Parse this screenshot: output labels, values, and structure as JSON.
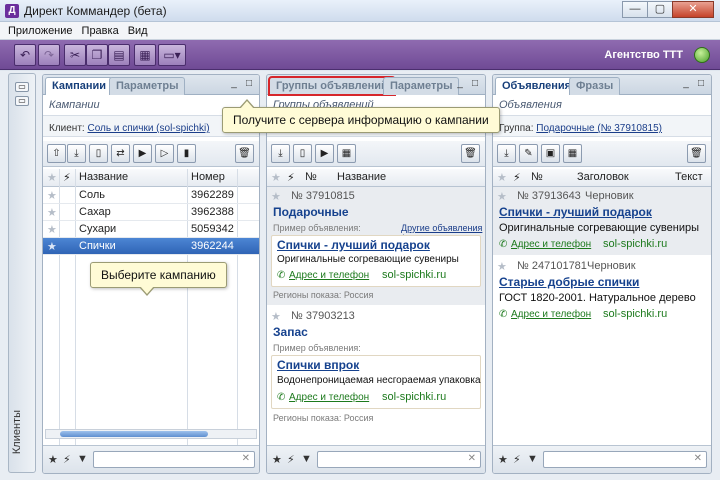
{
  "window": {
    "title": "Директ Коммандер (бета)",
    "min": "—",
    "max": "▢",
    "close": "✕"
  },
  "menu": [
    "Приложение",
    "Правка",
    "Вид"
  ],
  "toolbar": {
    "agency": "Агентство ТТТ"
  },
  "clients_rail": {
    "label": "Клиенты"
  },
  "campaigns_panel": {
    "tab_active": "Кампании",
    "tab_inactive": "Параметры",
    "subtitle": "Кампании",
    "client_label": "Клиент:",
    "client_link": "Соль и спички (sol-spichki)",
    "columns": {
      "name": "Название",
      "number": "Номер"
    },
    "rows": [
      {
        "name": "Соль",
        "number": "3962289"
      },
      {
        "name": "Сахар",
        "number": "3962388"
      },
      {
        "name": "Сухари",
        "number": "5059342"
      },
      {
        "name": "Спички",
        "number": "3962244"
      }
    ]
  },
  "groups_panel": {
    "tab_active": "Группы объявлений",
    "tab_inactive": "Параметры",
    "subtitle": "Группы объявлений",
    "columns": {
      "num": "№",
      "name": "Название"
    },
    "groups": [
      {
        "number": "№ 37910815",
        "name": "Подарочные",
        "example_label": "Пример объявления:",
        "other_link": "Другие объявления (",
        "ad_title": "Спички - лучший подарок",
        "ad_text": "Оригинальные согревающие сувениры",
        "contact": "Адрес и телефон",
        "domain": "sol-spichki.ru",
        "regions": "Регионы показа: Россия"
      },
      {
        "number": "№ 37903213",
        "name": "Запас",
        "example_label": "Пример объявления:",
        "ad_title": "Спички впрок",
        "ad_text": "Водонепроницаемая несгораемая упаковка",
        "contact": "Адрес и телефон",
        "domain": "sol-spichki.ru",
        "regions": "Регионы показа: Россия"
      }
    ]
  },
  "ads_panel": {
    "tab_active": "Объявления",
    "tab_inactive": "Фразы",
    "subtitle": "Объявления",
    "group_label": "Группа:",
    "group_link": "Подарочные (№ 37910815)",
    "columns": {
      "num": "№",
      "title": "Заголовок",
      "text": "Текст"
    },
    "ads": [
      {
        "number": "№ 37913643",
        "status": "Черновик",
        "title": "Спички - лучший подарок",
        "text": "Оригинальные согревающие сувениры",
        "contact": "Адрес и телефон",
        "domain": "sol-spichki.ru"
      },
      {
        "number": "№ 247101781",
        "status": "Черновик",
        "title": "Старые добрые спички",
        "text": "ГОСТ 1820-2001. Натуральное дерево",
        "contact": "Адрес и телефон",
        "domain": "sol-spichki.ru"
      }
    ]
  },
  "tooltips": {
    "server": "Получите с сервера информацию о кампании",
    "select": "Выберите кампанию"
  },
  "colors": {
    "toolbar": "#7a56a0",
    "selection": "#3a70c2",
    "highlight": "#d6262b",
    "link": "#16428e",
    "green": "#1d7a1d"
  }
}
